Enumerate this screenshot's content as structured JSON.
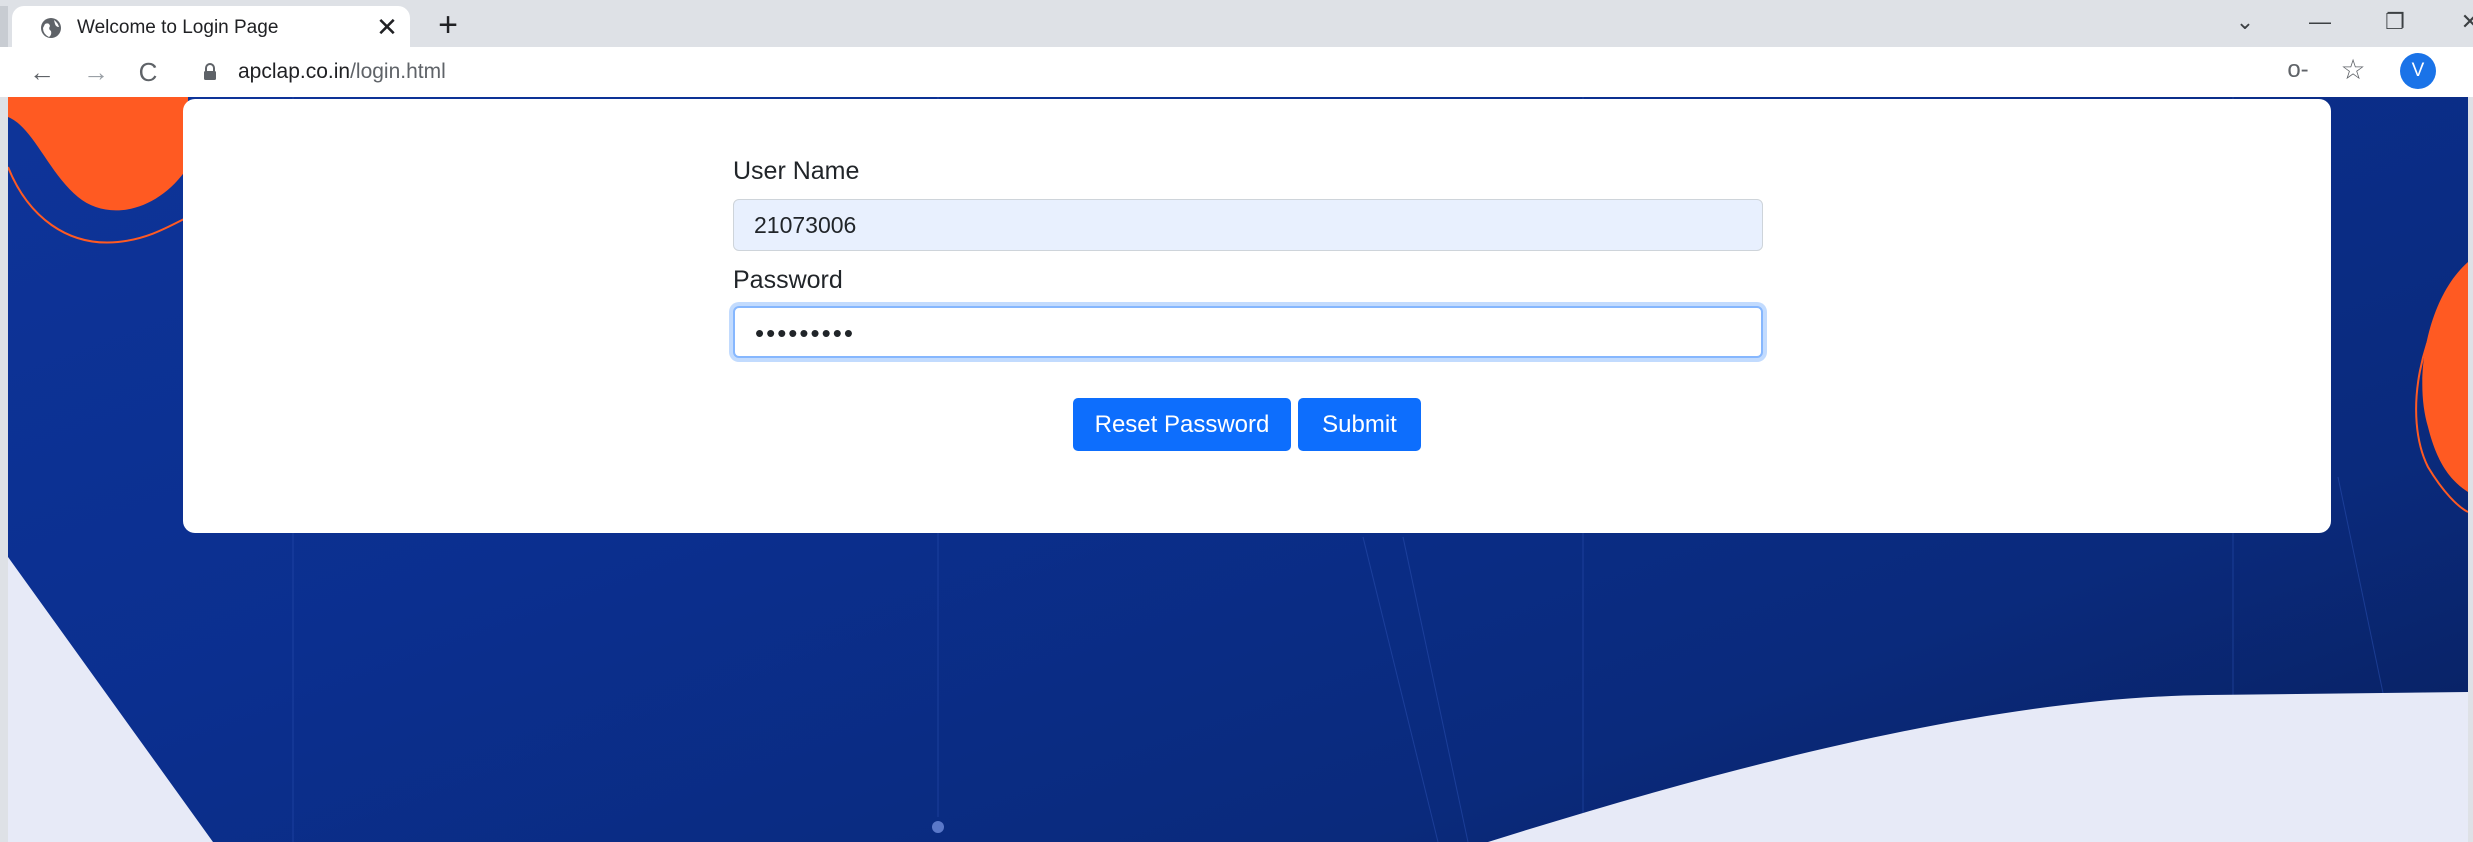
{
  "browser": {
    "tab_title": "Welcome to Login Page",
    "tab_close": "✕",
    "new_tab": "+",
    "window_controls": {
      "dropdown": "⌄",
      "minimize": "—",
      "restore": "❐",
      "close": "✕"
    },
    "nav": {
      "back": "←",
      "forward": "→",
      "reload": "C"
    },
    "url_host": "apclap.co.in",
    "url_path": "/login.html",
    "key_icon": "o-",
    "star_icon": "☆",
    "avatar_letter": "V"
  },
  "login": {
    "username_label": "User Name",
    "username_value": "21073006",
    "password_label": "Password",
    "password_value": "•••••••••",
    "reset_button": "Reset Password",
    "submit_button": "Submit"
  },
  "colors": {
    "primary": "#0d6efd",
    "background_blue": "#0b2f8f",
    "accent_orange": "#ff5a22",
    "wave_light": "#e7eaf7"
  }
}
